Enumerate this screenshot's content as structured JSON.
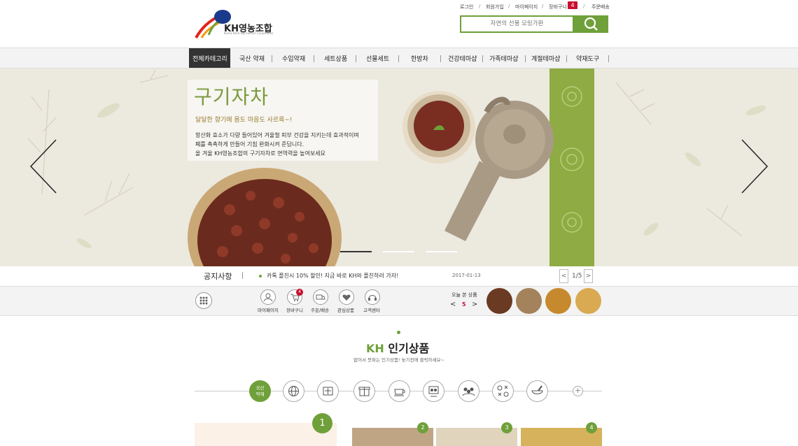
{
  "header": {
    "logo_text": "KH영농조합",
    "logo_sub": "Korea Herb Agriculture Corporation",
    "util_links": [
      "로그인",
      "회원가입",
      "마이페이지",
      "장바구니",
      "주문배송"
    ],
    "cart_count": "4",
    "search_placeholder": "자연의 선물 모링가환",
    "colors": {
      "accent": "#6fa03a",
      "badge": "#c8102e"
    }
  },
  "nav": {
    "items": [
      "전체카테고리",
      "국산 약재",
      "수입약재",
      "세트상품",
      "선물세트",
      "한방차",
      "건강테마샵",
      "가족테마샵",
      "계절테마샵",
      "약재도구"
    ],
    "active": "전체카테고리"
  },
  "hero": {
    "title": "구기자차",
    "subtitle": "달달한 향기에 몸도 마음도 사르륵~!",
    "desc": [
      "항산화 효소가 다량 들어있어 겨울철 피부 건강을 지키는데 효과적이며",
      "폐를 촉촉하게 만들어 기침 완화시켜 준답니다.",
      "올 겨울 KH영농조합의 구기자차로 면역력을 높여보세요"
    ],
    "slides": 3,
    "active_slide": 1
  },
  "notice": {
    "title": "공지사항",
    "text": "카톡 플친시 10% 할인! 지금 바로 KH와 플친하러 가자!",
    "date": "2017-01-13",
    "page": "1/5"
  },
  "quick": {
    "items": [
      "마이페이지",
      "장바구니",
      "주문/배송",
      "관심상품",
      "고객센터"
    ],
    "cart_badge": "4",
    "recent_label": "오늘 본 상품",
    "recent_count": "5"
  },
  "popular": {
    "title_kh": "KH",
    "title_rest": "인기상품",
    "subtitle": "없어서 못파는 인기상품! 늦기전에 클릭하세요~",
    "active_category": "국산\n약재",
    "category_icons": [
      "globe-icon",
      "ginseng-icon",
      "gift-box-icon",
      "tea-cup-icon",
      "family-icon",
      "people-group-icon",
      "seasons-icon",
      "mortar-icon"
    ],
    "ranks": [
      "1",
      "2",
      "3",
      "4"
    ]
  }
}
